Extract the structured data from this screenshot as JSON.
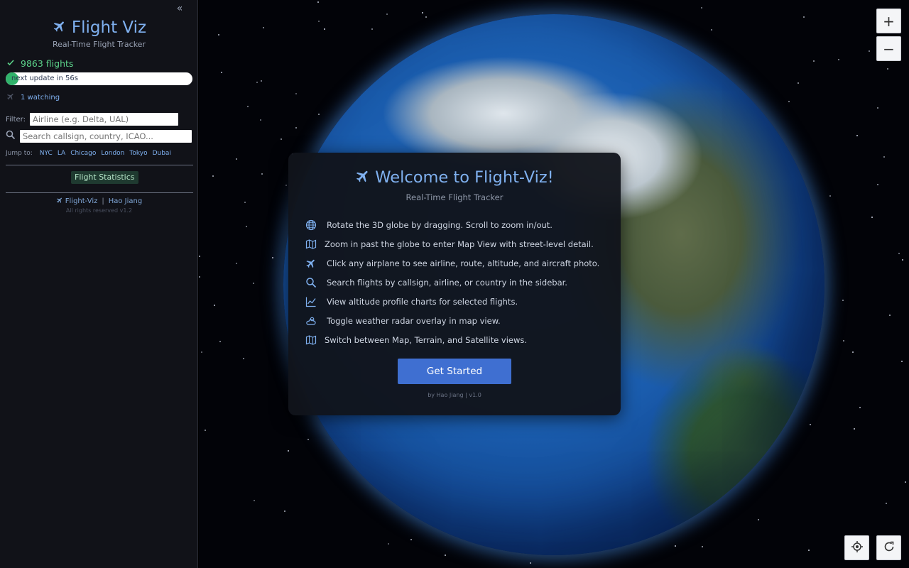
{
  "sidebar": {
    "collapse_glyph": "«",
    "brand_title": "Flight Viz",
    "brand_subtitle": "Real-Time Flight Tracker",
    "flight_count": "9863 flights",
    "progress_text": "next update in 56s",
    "progress_fraction": 0.07,
    "watching": "1 watching",
    "filter_label": "Filter:",
    "filter_placeholder": "Airline (e.g. Delta, UAL)",
    "search_placeholder": "Search callsign, country, ICAO...",
    "jump_label": "Jump to:",
    "jump_links": [
      "NYC",
      "LA",
      "Chicago",
      "London",
      "Tokyo",
      "Dubai"
    ],
    "stats_button": "Flight Statistics",
    "footer_app": "Flight-Viz",
    "footer_author": "Hao Jiang",
    "footer_sep": "|",
    "footer_rights": "All rights reserved",
    "footer_version": "v1.2"
  },
  "controls": {
    "zoom_in": "+",
    "zoom_out": "−",
    "icons": [
      "locate-icon",
      "reset-icon"
    ]
  },
  "modal": {
    "title": "Welcome to Flight-Viz!",
    "subtitle": "Real-Time Flight Tracker",
    "tips": [
      {
        "icon": "globe-icon",
        "text": "Rotate the 3D globe by dragging. Scroll to zoom in/out."
      },
      {
        "icon": "map-icon",
        "text": "Zoom in past the globe to enter Map View with street-level detail."
      },
      {
        "icon": "plane-icon",
        "text": "Click any airplane to see airline, route, altitude, and aircraft photo."
      },
      {
        "icon": "search-icon",
        "text": "Search flights by callsign, airline, or country in the sidebar."
      },
      {
        "icon": "chart-icon",
        "text": "View altitude profile charts for selected flights."
      },
      {
        "icon": "weather-icon",
        "text": "Toggle weather radar overlay in map view."
      },
      {
        "icon": "map-icon",
        "text": "Switch between Map, Terrain, and Satellite views."
      }
    ],
    "start_button": "Get Started",
    "footer_by": "by Hao Jiang",
    "footer_sep": "|",
    "footer_version": "v1.0"
  },
  "colors": {
    "accent": "#7fb0ef",
    "success": "#5cd38a",
    "button": "#3f6fd1",
    "sidebar_bg": "#111218"
  }
}
